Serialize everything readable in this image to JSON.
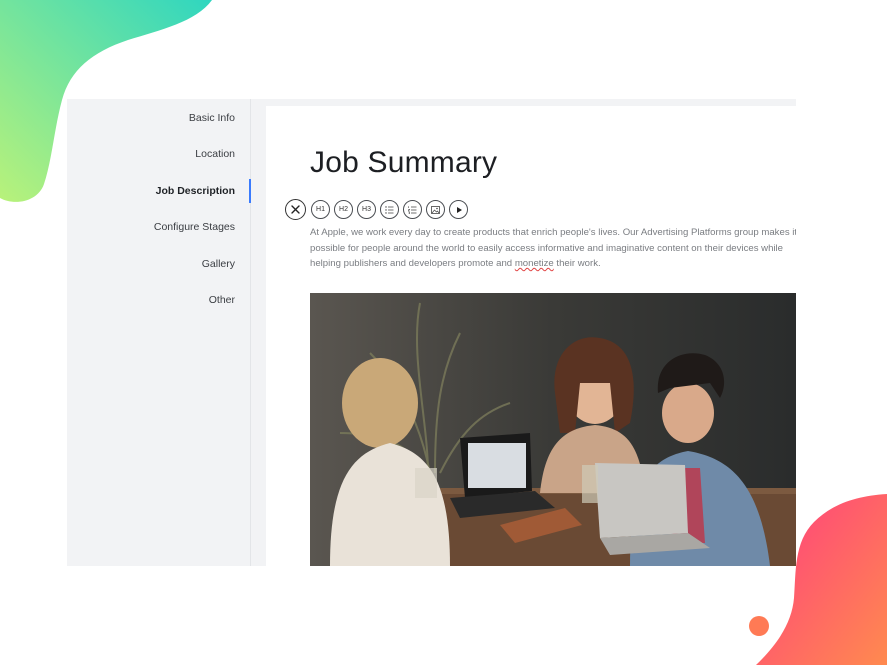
{
  "sidebar": {
    "items": [
      {
        "label": "Basic Info",
        "active": false
      },
      {
        "label": "Location",
        "active": false
      },
      {
        "label": "Job Description",
        "active": true
      },
      {
        "label": "Configure Stages",
        "active": false
      },
      {
        "label": "Gallery",
        "active": false
      },
      {
        "label": "Other",
        "active": false
      }
    ]
  },
  "editor": {
    "title": "Job Summary",
    "toolbar": {
      "close_icon": "close-icon",
      "buttons": [
        {
          "label": "H1",
          "icon": null
        },
        {
          "label": "H2",
          "icon": null
        },
        {
          "label": "H3",
          "icon": null
        },
        {
          "label": "",
          "icon": "unordered-list-icon"
        },
        {
          "label": "",
          "icon": "ordered-list-icon"
        },
        {
          "label": "",
          "icon": "image-icon"
        },
        {
          "label": "",
          "icon": "video-play-icon"
        }
      ]
    },
    "body_before": "At Apple, we work every day to create products that enrich people's lives. Our Advertising Platforms group makes it possible for people around the world to easily access informative and imaginative content on their devices while helping publishers and developers promote and ",
    "body_misspelled": "monetize",
    "body_after": " their work."
  },
  "colors": {
    "accent": "#3a7bfd",
    "top_blob_start": "#b9f27a",
    "top_blob_end": "#2fd6c0",
    "bottom_blob_start": "#ff3d7f",
    "bottom_blob_end": "#ff8a4f"
  }
}
